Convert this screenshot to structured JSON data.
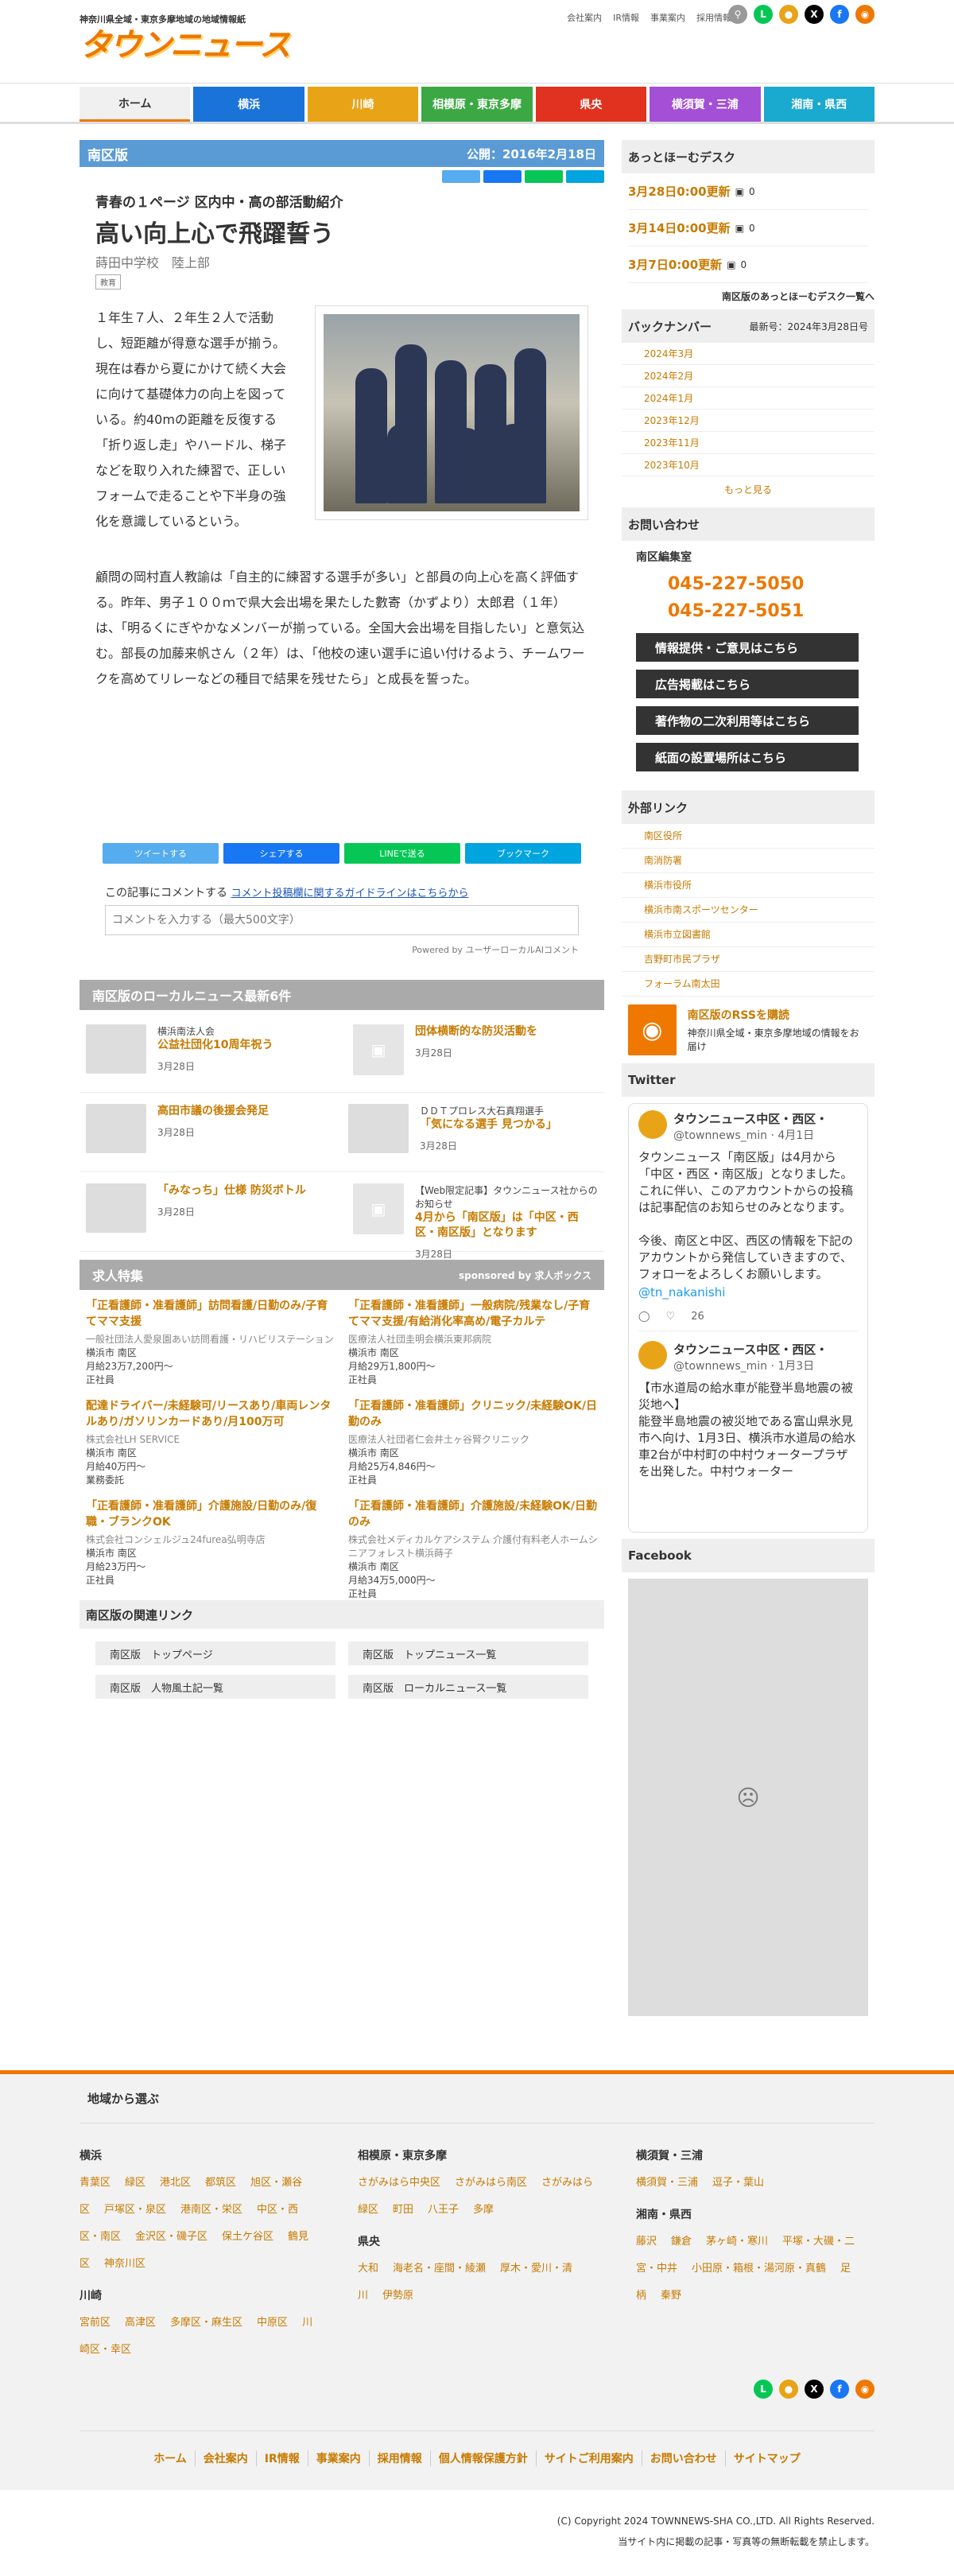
{
  "header": {
    "tagline": "神奈川県全域・東京多摩地域の地域情報紙",
    "logo": "タウンニュース",
    "links": [
      "会社案内",
      "IR情報",
      "事業案内",
      "採用情報"
    ]
  },
  "nav": [
    {
      "label": "ホーム",
      "color": "#f0f0f0"
    },
    {
      "label": "横浜",
      "color": "#1a73d9"
    },
    {
      "label": "川崎",
      "color": "#e8a317"
    },
    {
      "label": "相模原・東京多摩",
      "color": "#3ca843"
    },
    {
      "label": "県央",
      "color": "#e0321f"
    },
    {
      "label": "横須賀・三浦",
      "color": "#a34fd6"
    },
    {
      "label": "湘南・県西",
      "color": "#1aa9cf"
    }
  ],
  "edition": {
    "name": "南区版",
    "date": "公開：2016年2月18日"
  },
  "article": {
    "subtitle": "青春の１ページ 区内中・高の部活動紹介",
    "title": "高い向上心で飛躍誓う",
    "school": "蒔田中学校　陸上部",
    "tag": "教育",
    "body1": "１年生７人、２年生２人で活動し、短距離が得意な選手が揃う。現在は春から夏にかけて続く大会に向けて基礎体力の向上を図っている。約40mの距離を反復する「折り返し走」やハードル、梯子などを取り入れた練習で、正しいフォームで走ることや下半身の強化を意識しているという。",
    "body2": "顧問の岡村直人教諭は「自主的に練習する選手が多い」と部員の向上心を高く評価する。昨年、男子１００ｍで県大会出場を果たした數寄（かずより）太郎君（１年）は、「明るくにぎやかなメンバーが揃っている。全国大会出場を目指したい」と意気込む。部長の加藤来帆さん（２年）は、「他校の速い選手に追い付けるよう、チームワークを高めてリレーなどの種目で結果を残せたら」と成長を誓った。"
  },
  "share": [
    {
      "label": "ツイートする",
      "color": "#55acee"
    },
    {
      "label": "シェアする",
      "color": "#1877f2"
    },
    {
      "label": "LINEで送る",
      "color": "#06c755"
    },
    {
      "label": "ブックマーク",
      "color": "#00a4de"
    }
  ],
  "comment": {
    "label": "この記事にコメントする",
    "guide": "コメント投稿欄に関するガイドラインはこちらから",
    "placeholder": "コメントを入力する（最大500文字）",
    "powered": "Powered by ユーザーローカルAIコメント"
  },
  "local_news": {
    "heading": "南区版のローカルニュース最新6件",
    "items": [
      {
        "small": "横浜南法人会",
        "title": "公益社団化10周年祝う",
        "date": "3月28日",
        "thumb": "photo"
      },
      {
        "small": "",
        "title": "団体横断的な防災活動を",
        "date": "3月28日",
        "thumb": "placeholder"
      },
      {
        "small": "",
        "title": "高田市議の後援会発足",
        "date": "3月28日",
        "thumb": "photo"
      },
      {
        "small": "ＤＤＴプロレス大石真翔選手",
        "title": "「気になる選手 見つかる」",
        "date": "3月28日",
        "thumb": "photo"
      },
      {
        "small": "",
        "title": "「みなっち」仕様 防災ボトル",
        "date": "3月28日",
        "thumb": "photo"
      },
      {
        "small": "【Web限定記事】タウンニュース社からのお知らせ",
        "title": "4月から「南区版」は「中区・西区・南区版」となります",
        "date": "3月28日",
        "thumb": "placeholder"
      }
    ]
  },
  "jobs": {
    "heading": "求人特集",
    "sponsor": "sponsored by 求人ボックス",
    "items": [
      {
        "title": "「正看護師・准看護師」訪問看護/日勤のみ/子育てママ支援",
        "company": "一般社団法人愛泉園あい訪問看護・リハビリステーション",
        "area": "横浜市 南区",
        "pay": "月給23万7,200円〜",
        "type": "正社員"
      },
      {
        "title": "「正看護師・准看護師」一般病院/残業なし/子育てママ支援/有給消化率高め/電子カルテ",
        "company": "医療法人社団圭明会横浜東邦病院",
        "area": "横浜市 南区",
        "pay": "月給29万1,800円〜",
        "type": "正社員"
      },
      {
        "title": "配達ドライバー/未経験可/リースあり/車両レンタルあり/ガソリンカードあり/月100万可",
        "company": "株式会社LH SERVICE",
        "area": "横浜市 南区",
        "pay": "月給40万円〜",
        "type": "業務委託"
      },
      {
        "title": "「正看護師・准看護師」クリニック/未経験OK/日勤のみ",
        "company": "医療法人社団者仁会井土ヶ谷腎クリニック",
        "area": "横浜市 南区",
        "pay": "月給25万4,846円〜",
        "type": "正社員"
      },
      {
        "title": "「正看護師・准看護師」介護施設/日勤のみ/復職・ブランクOK",
        "company": "株式会社コンシェルジュ24furea弘明寺店",
        "area": "横浜市 南区",
        "pay": "月給23万円〜",
        "type": "正社員"
      },
      {
        "title": "「正看護師・准看護師」介護施設/未経験OK/日勤のみ",
        "company": "株式会社メディカルケアシステム 介護付有料老人ホームシニアフォレスト横浜蒔子",
        "area": "横浜市 南区",
        "pay": "月給34万5,000円〜",
        "type": "正社員"
      }
    ]
  },
  "related": {
    "heading": "南区版の関連リンク",
    "links": [
      "南区版　トップページ",
      "南区版　トップニュース一覧",
      "南区版　人物風土記一覧",
      "南区版　ローカルニュース一覧"
    ]
  },
  "sidebar": {
    "desk_heading": "あっとほーむデスク",
    "desk": [
      {
        "label": "3月28日0:00更新",
        "count": "0"
      },
      {
        "label": "3月14日0:00更新",
        "count": "0"
      },
      {
        "label": "3月7日0:00更新",
        "count": "0"
      }
    ],
    "desk_link": "南区版のあっとほーむデスク一覧へ",
    "backnumber_heading": "バックナンバー",
    "backnumber_latest": "最新号：2024年3月28日号",
    "backnumbers": [
      "2024年3月",
      "2024年2月",
      "2024年1月",
      "2023年12月",
      "2023年11月",
      "2023年10月"
    ],
    "more": "もっと見る",
    "contact_heading": "お問い合わせ",
    "office": "南区編集室",
    "tel1": "045-227-5050",
    "tel2": "045-227-5051",
    "buttons": [
      "情報提供・ご意見はこちら",
      "広告掲載はこちら",
      "著作物の二次利用等はこちら",
      "紙面の設置場所はこちら"
    ],
    "ext_heading": "外部リンク",
    "ext_links": [
      "南区役所",
      "南消防署",
      "横浜市役所",
      "横浜市南スポーツセンター",
      "横浜市立図書館",
      "吉野町市民プラザ",
      "フォーラム南太田"
    ],
    "rss_title": "南区版のRSSを購読",
    "rss_desc": "神奈川県全域・東京多摩地域の情報をお届け",
    "twitter_heading": "Twitter",
    "tweets": [
      {
        "name": "タウンニュース中区・西区・",
        "handle": "@townnews_min · 4月1日",
        "text": "タウンニュース「南区版」は4月から「中区・西区・南区版」となりました。これに伴い、このアカウントからの投稿は記事配信のお知らせのみとなります。\n\n今後、南区と中区、西区の情報を下記のアカウントから発信していきますので、フォローをよろしくお願いします。",
        "mention": "@tn_nakanishi",
        "likes": "26"
      },
      {
        "name": "タウンニュース中区・西区・",
        "handle": "@townnews_min · 1月3日",
        "text": "【市水道局の給水車が能登半島地震の被災地へ】\n能登半島地震の被災地である富山県氷見市へ向け、1月3日、横浜市水道局の給水車2台が中村町の中村ウォータープラザを出発した。中村ウォーター",
        "mention": "",
        "likes": ""
      }
    ],
    "facebook_heading": "Facebook"
  },
  "footer": {
    "heading": "地域から選ぶ",
    "col1": [
      {
        "area": "横浜",
        "links": [
          "青葉区",
          "緑区",
          "港北区",
          "都筑区",
          "旭区・瀬谷区",
          "戸塚区・泉区",
          "港南区・栄区",
          "中区・西区・南区",
          "金沢区・磯子区",
          "保土ケ谷区",
          "鶴見区",
          "神奈川区"
        ]
      },
      {
        "area": "川崎",
        "links": [
          "宮前区",
          "高津区",
          "多摩区・麻生区",
          "中原区",
          "川崎区・幸区"
        ]
      }
    ],
    "col2": [
      {
        "area": "相模原・東京多摩",
        "links": [
          "さがみはら中央区",
          "さがみはら南区",
          "さがみはら緑区",
          "町田",
          "八王子",
          "多摩"
        ]
      },
      {
        "area": "県央",
        "links": [
          "大和",
          "海老名・座間・綾瀬",
          "厚木・愛川・清川",
          "伊勢原"
        ]
      }
    ],
    "col3": [
      {
        "area": "横須賀・三浦",
        "links": [
          "横須賀・三浦",
          "逗子・葉山"
        ]
      },
      {
        "area": "湘南・県西",
        "links": [
          "藤沢",
          "鎌倉",
          "茅ヶ崎・寒川",
          "平塚・大磯・二宮・中井",
          "小田原・箱根・湯河原・真鶴",
          "足柄",
          "秦野"
        ]
      }
    ],
    "nav": [
      "ホーム",
      "会社案内",
      "IR情報",
      "事業案内",
      "採用情報",
      "個人情報保護方針",
      "サイトご利用案内",
      "お問い合わせ",
      "サイトマップ"
    ],
    "copyright": "(C) Copyright 2024 TOWNNEWS-SHA CO.,LTD. All Rights Reserved.",
    "notice": "当サイト内に掲載の記事・写真等の無断転載を禁止します。"
  }
}
